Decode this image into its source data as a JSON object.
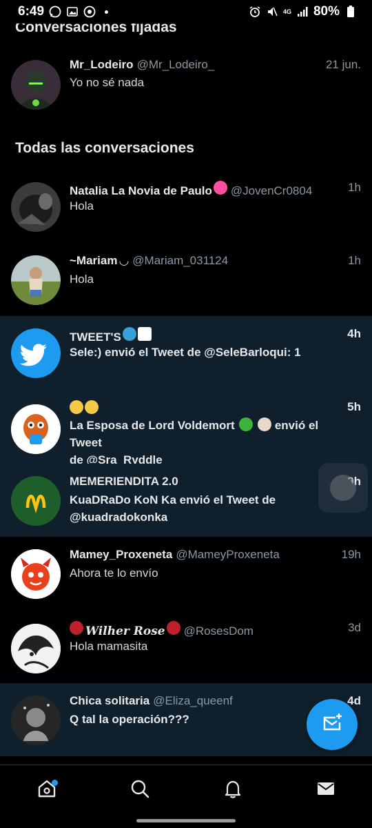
{
  "status_bar": {
    "time": "6:49",
    "battery": "80%",
    "network": "4G"
  },
  "pinned": {
    "title": "Conversaciones fijadas",
    "items": [
      {
        "name": "Mr_Lodeiro",
        "handle": "@Mr_Lodeiro_",
        "time": "21 jun.",
        "message": "Yo no sé nada"
      }
    ]
  },
  "all": {
    "title": "Todas las conversaciones",
    "items": [
      {
        "name": "Natalia La Novia de Paulo",
        "handle": "@JovenCr0804",
        "time": "1h",
        "message": "Hola"
      },
      {
        "name": "~Mariam",
        "handle": "@Mariam_031124",
        "time": "1h",
        "message": "Hola"
      },
      {
        "name": "TWEET'S",
        "handle": "",
        "time": "4h",
        "message": "Sele:) envió el Tweet de @SeleBarloqui: 1"
      },
      {
        "name": "",
        "handle": "",
        "time": "5h",
        "message_line1_prefix": "La Esposa de Lord Voldemort",
        "message_line1_suffix": "envió el Tweet",
        "message_line2": "de @Sra_Ryddle"
      },
      {
        "name": "MEMERIENDITA 2.0",
        "handle": "",
        "time": "9h",
        "message_line1": "KuaDRaDo KoN Ka envió el Tweet de",
        "message_line2": "@kuadradokonka"
      },
      {
        "name": "Mamey_Proxeneta",
        "handle": "@MameyProxeneta",
        "time": "19h",
        "message": "Ahora te lo envío"
      },
      {
        "name": "Wilher Rose",
        "handle": "@RosesDom",
        "time": "3d",
        "message": "Hola mamasita"
      },
      {
        "name": "Chica solitaria",
        "handle": "@Eliza_queenf",
        "time": "4d",
        "message": "Q tal la operación???"
      }
    ]
  },
  "icons": {
    "home": "home-icon",
    "search": "search-icon",
    "notifications": "bell-icon",
    "messages": "mail-icon",
    "compose": "compose-message-icon"
  },
  "colors": {
    "accent": "#1d9bf0",
    "highlight_row": "#0f1f2c",
    "background": "#000000"
  }
}
